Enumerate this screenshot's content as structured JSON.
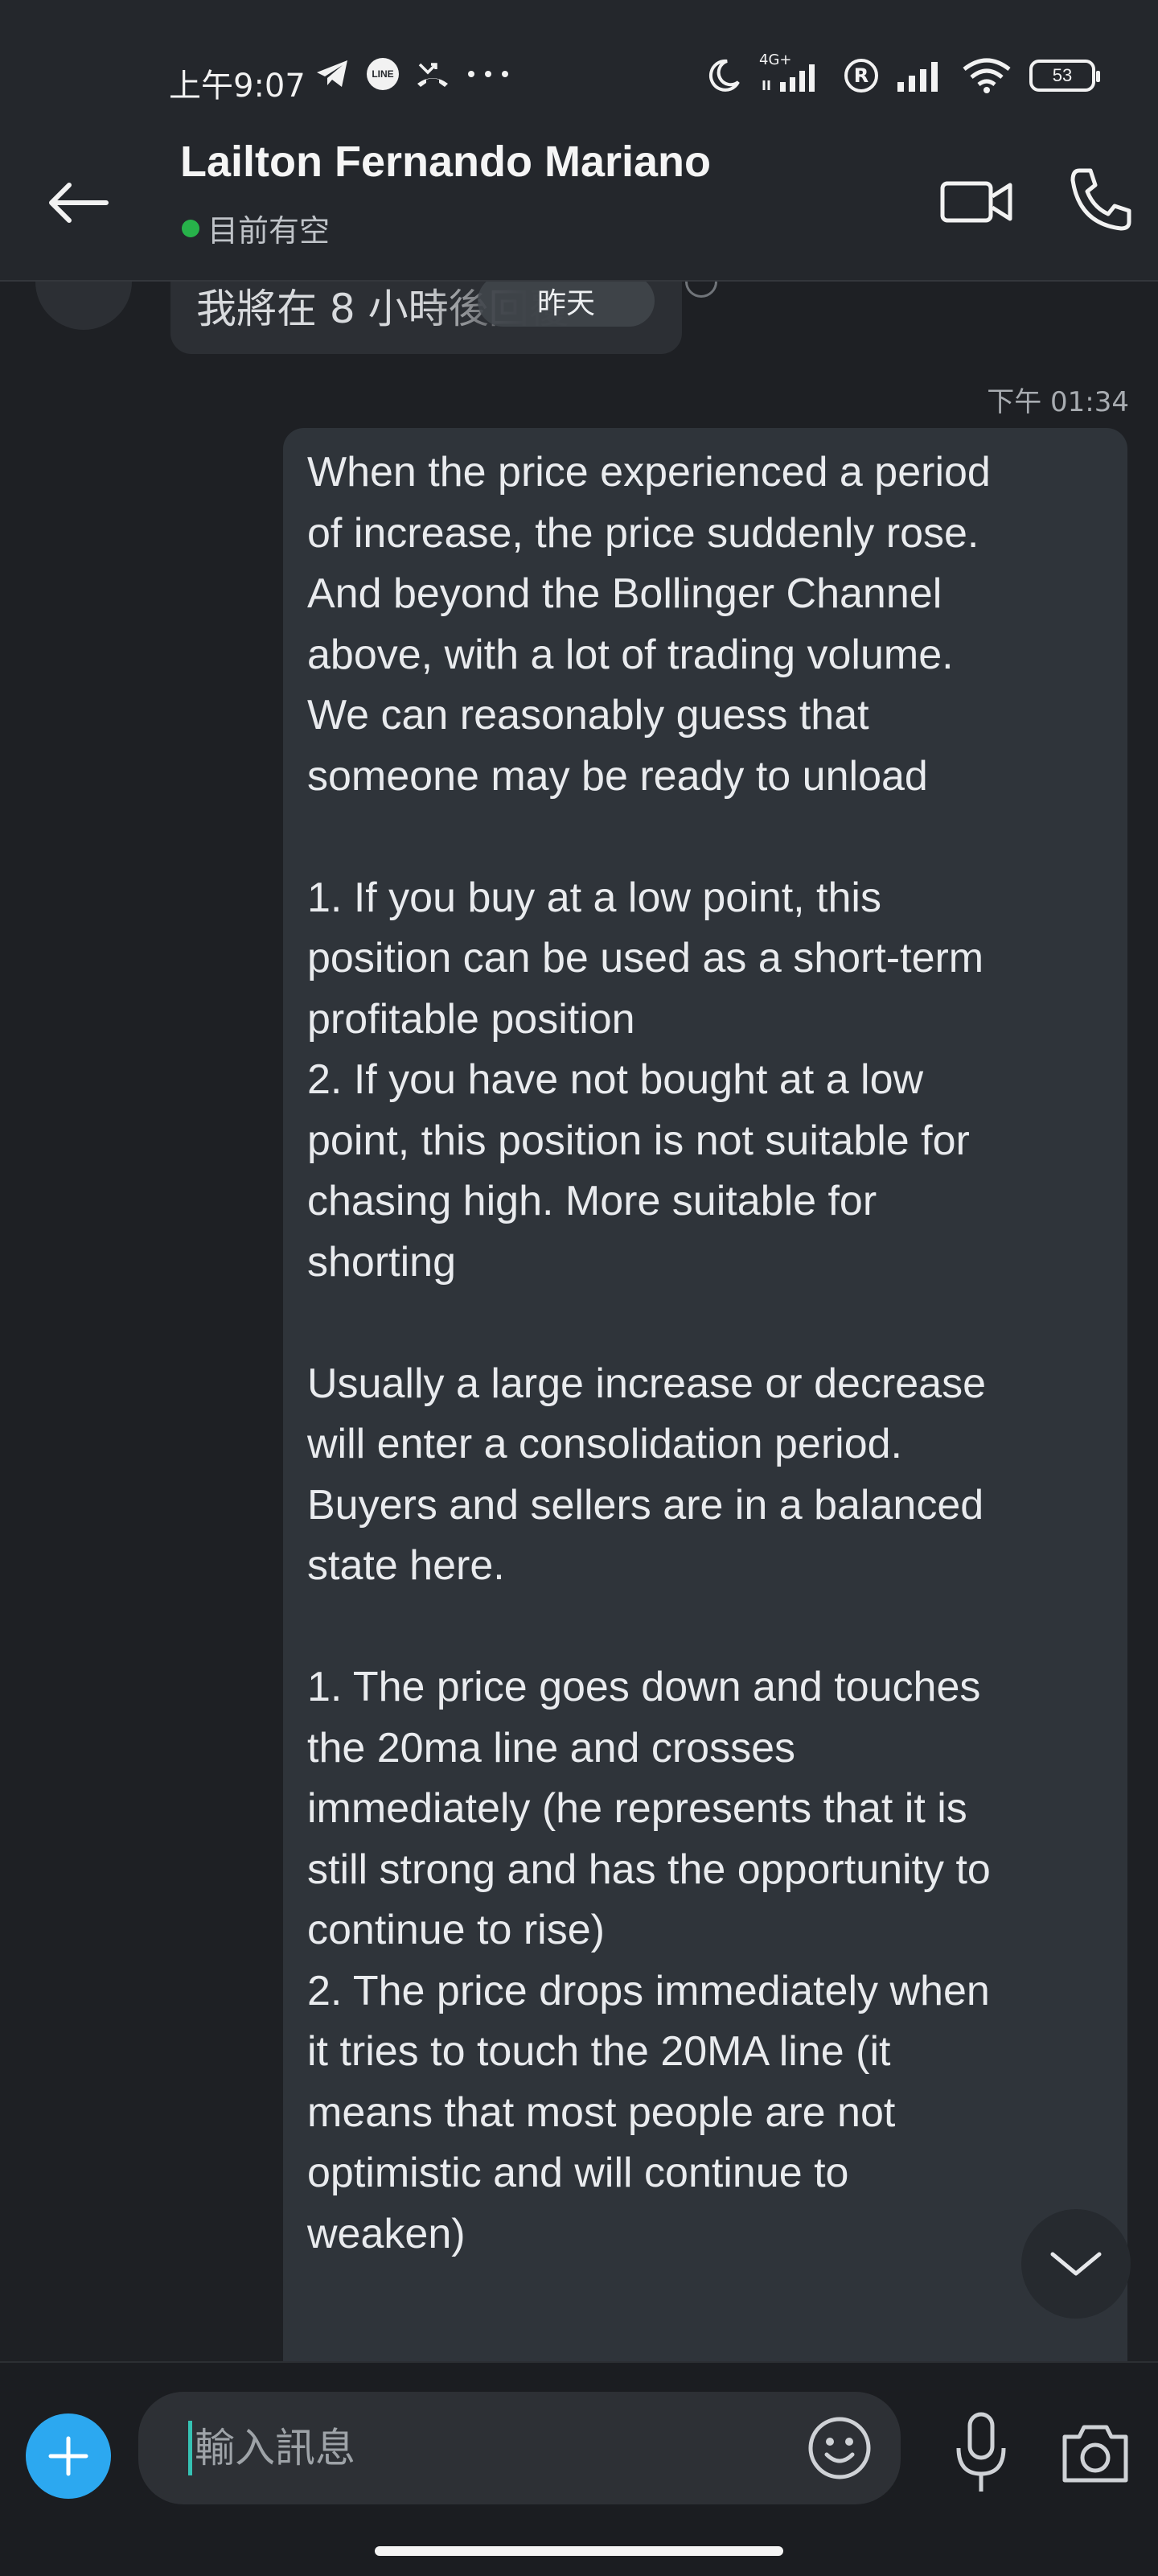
{
  "status_bar": {
    "time": "上午9:07",
    "network_type": "4G+",
    "battery": "53"
  },
  "header": {
    "contact_name": "Lailton Fernando Mariano",
    "presence": "目前有空"
  },
  "chat": {
    "incoming_partial_text": "我將在 8 小時後回覆",
    "date_divider": "昨天",
    "message_time": "下午 01:34",
    "message_text": "When the price experienced a period\nof increase, the price suddenly rose.\nAnd beyond the Bollinger Channel\nabove, with a lot of trading volume.\nWe can reasonably guess that\nsomeone may be ready to unload\n\n1. If you buy at a low point, this\nposition can be used as a short-term\nprofitable position\n2. If you have not bought at a low\npoint, this position is not suitable for\nchasing high. More suitable for\nshorting\n\nUsually a large increase or decrease\nwill enter a consolidation period.\nBuyers and sellers are in a balanced\nstate here.\n\n1. The price goes down and touches\nthe 20ma line and crosses\nimmediately (he represents that it is\nstill strong and has the opportunity to\ncontinue to rise)\n2. The price drops immediately when\nit tries to touch the 20MA line (it\nmeans that most people are not\noptimistic and will continue to\nweaken)"
  },
  "composer": {
    "placeholder": "輸入訊息"
  },
  "colors": {
    "accent": "#2ca8f0",
    "presence": "#27b24a",
    "bubble": "#2f343a"
  },
  "icons": {
    "back": "arrow-left-icon",
    "video": "video-call-icon",
    "phone": "phone-call-icon",
    "add": "plus-icon",
    "emoji": "emoji-icon",
    "mic": "microphone-icon",
    "camera": "camera-icon",
    "scroll": "chevron-down-icon"
  }
}
